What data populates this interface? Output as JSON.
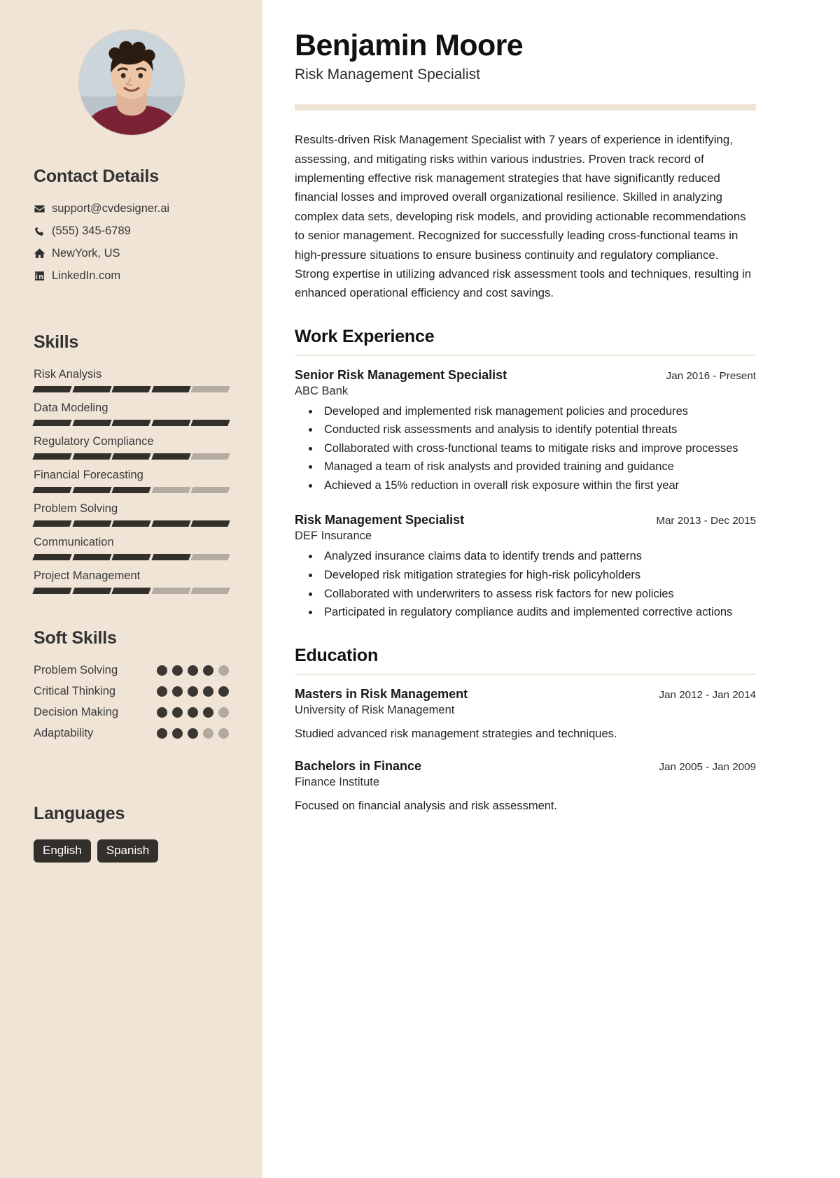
{
  "header": {
    "name": "Benjamin Moore",
    "role": "Risk Management Specialist"
  },
  "summary": "Results-driven Risk Management Specialist with 7 years of experience in identifying, assessing, and mitigating risks within various industries. Proven track record of implementing effective risk management strategies that have significantly reduced financial losses and improved overall organizational resilience. Skilled in analyzing complex data sets, developing risk models, and providing actionable recommendations to senior management. Recognized for successfully leading cross-functional teams in high-pressure situations to ensure business continuity and regulatory compliance. Strong expertise in utilizing advanced risk assessment tools and techniques, resulting in enhanced operational efficiency and cost savings.",
  "contact": {
    "heading": "Contact Details",
    "items": [
      {
        "icon": "envelope-icon",
        "text": "support@cvdesigner.ai"
      },
      {
        "icon": "phone-icon",
        "text": "(555) 345-6789"
      },
      {
        "icon": "home-icon",
        "text": "NewYork, US"
      },
      {
        "icon": "linkedin-icon",
        "text": "LinkedIn.com"
      }
    ]
  },
  "skills": {
    "heading": "Skills",
    "max": 5,
    "items": [
      {
        "name": "Risk Analysis",
        "level": 4
      },
      {
        "name": "Data Modeling",
        "level": 5
      },
      {
        "name": "Regulatory Compliance",
        "level": 4
      },
      {
        "name": "Financial Forecasting",
        "level": 3
      },
      {
        "name": "Problem Solving",
        "level": 5
      },
      {
        "name": "Communication",
        "level": 4
      },
      {
        "name": "Project Management",
        "level": 3
      }
    ]
  },
  "soft_skills": {
    "heading": "Soft Skills",
    "max": 5,
    "items": [
      {
        "name": "Problem Solving",
        "level": 4
      },
      {
        "name": "Critical Thinking",
        "level": 5
      },
      {
        "name": "Decision Making",
        "level": 4
      },
      {
        "name": "Adaptability",
        "level": 3
      }
    ]
  },
  "languages": {
    "heading": "Languages",
    "items": [
      "English",
      "Spanish"
    ]
  },
  "work": {
    "heading": "Work Experience",
    "entries": [
      {
        "title": "Senior Risk Management Specialist",
        "org": "ABC Bank",
        "date": "Jan 2016 - Present",
        "bullets": [
          "Developed and implemented risk management policies and procedures",
          "Conducted risk assessments and analysis to identify potential threats",
          "Collaborated with cross-functional teams to mitigate risks and improve processes",
          "Managed a team of risk analysts and provided training and guidance",
          "Achieved a 15% reduction in overall risk exposure within the first year"
        ]
      },
      {
        "title": "Risk Management Specialist",
        "org": "DEF Insurance",
        "date": "Mar 2013 - Dec 2015",
        "bullets": [
          "Analyzed insurance claims data to identify trends and patterns",
          "Developed risk mitigation strategies for high-risk policyholders",
          "Collaborated with underwriters to assess risk factors for new policies",
          "Participated in regulatory compliance audits and implemented corrective actions"
        ]
      }
    ]
  },
  "education": {
    "heading": "Education",
    "entries": [
      {
        "title": "Masters in Risk Management",
        "org": "University of Risk Management",
        "date": "Jan 2012 - Jan 2014",
        "desc": "Studied advanced risk management strategies and techniques."
      },
      {
        "title": "Bachelors in Finance",
        "org": "Finance Institute",
        "date": "Jan 2005 - Jan 2009",
        "desc": "Focused on financial analysis and risk assessment."
      }
    ]
  },
  "colors": {
    "sidebar_bg": "#f0e4d6",
    "accent_rule": "#efe3d5",
    "ink": "#332f2b",
    "muted": "#b4aca0"
  }
}
